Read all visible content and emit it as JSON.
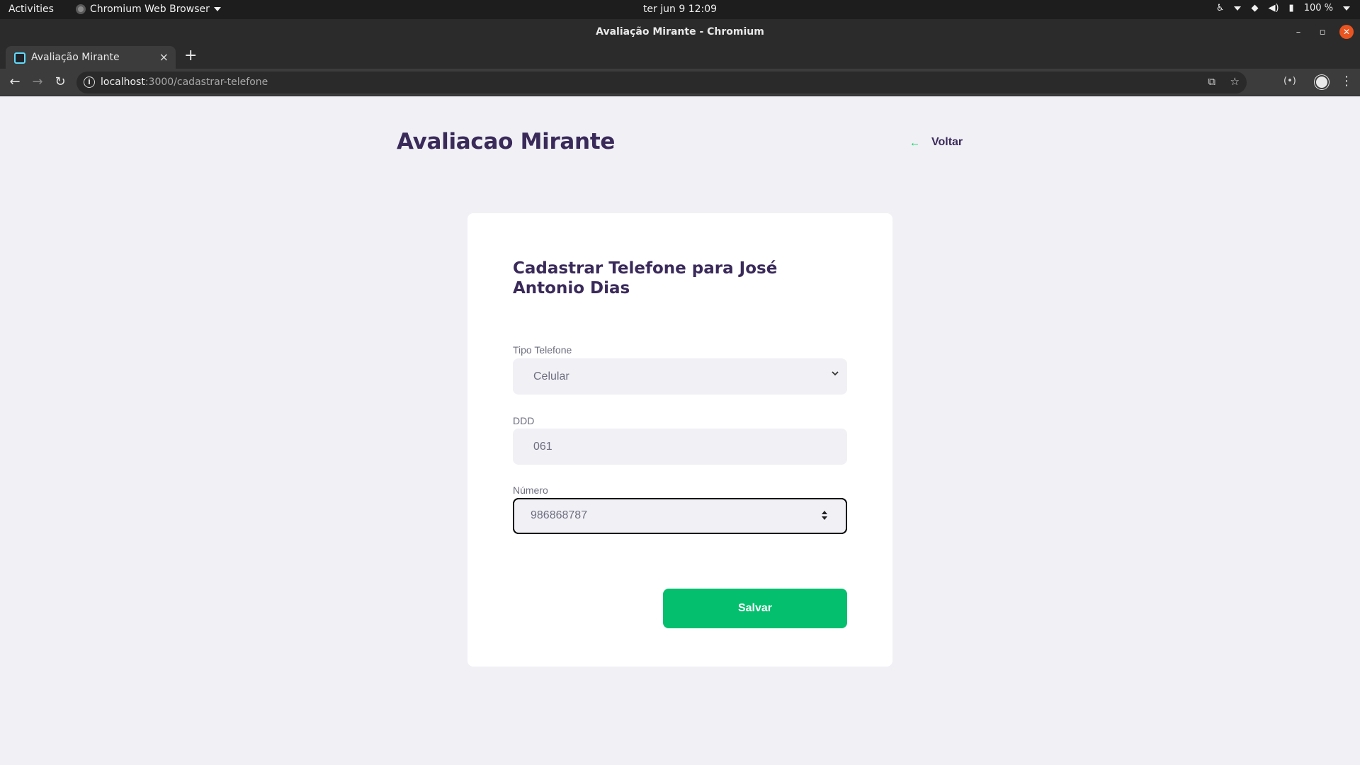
{
  "system": {
    "activities": "Activities",
    "app_menu": "Chromium Web Browser",
    "clock": "ter jun 9  12:09",
    "battery": "100 %"
  },
  "window": {
    "title": "Avaliação Mirante - Chromium"
  },
  "tab": {
    "label": "Avaliação Mirante",
    "close": "×",
    "new_tab": "+"
  },
  "address_bar": {
    "host": "localhost",
    "path": ":3000/cadastrar-telefone"
  },
  "page": {
    "app_title": "Avaliacao Mirante",
    "back_label": "Voltar",
    "form": {
      "heading": "Cadastrar Telefone para José Antonio Dias",
      "tipo_label": "Tipo Telefone",
      "tipo_value": "Celular",
      "ddd_label": "DDD",
      "ddd_value": "061",
      "numero_label": "Número",
      "numero_value": "986868787",
      "save_label": "Salvar"
    }
  },
  "colors": {
    "accent_green": "#04bf6d",
    "title_purple": "#3a2a5a",
    "page_bg": "#f0f0f5"
  }
}
